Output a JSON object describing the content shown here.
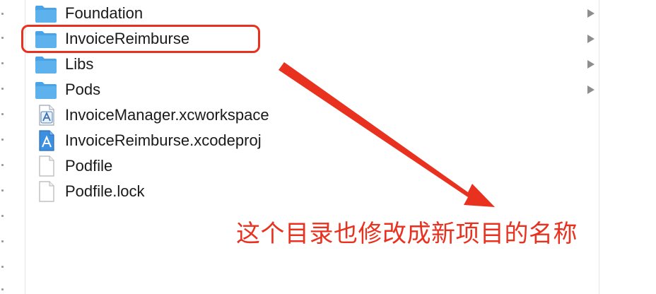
{
  "colors": {
    "annotation_red": "#e8311f",
    "folder_blue": "#5db2ee",
    "disclosure_gray": "#8e8e8e"
  },
  "files": [
    {
      "name": "Foundation",
      "icon": "folder-icon",
      "expandable": true
    },
    {
      "name": "InvoiceReimburse",
      "icon": "folder-icon",
      "expandable": true
    },
    {
      "name": "Libs",
      "icon": "folder-icon",
      "expandable": true
    },
    {
      "name": "Pods",
      "icon": "folder-icon",
      "expandable": true
    },
    {
      "name": "InvoiceManager.xcworkspace",
      "icon": "xcworkspace-file-icon",
      "expandable": false
    },
    {
      "name": "InvoiceReimburse.xcodeproj",
      "icon": "xcodeproj-file-icon",
      "expandable": false
    },
    {
      "name": "Podfile",
      "icon": "document-icon",
      "expandable": false
    },
    {
      "name": "Podfile.lock",
      "icon": "document-icon",
      "expandable": false
    }
  ],
  "annotation": {
    "text": "这个目录也修改成新项目的名称"
  }
}
